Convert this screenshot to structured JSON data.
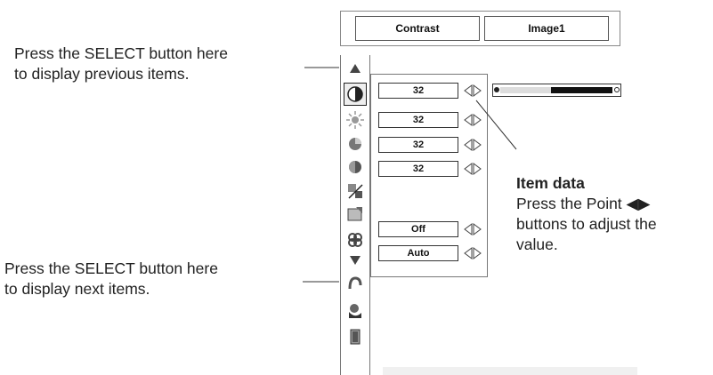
{
  "header": {
    "tab_contrast": "Contrast",
    "tab_image": "Image1"
  },
  "callouts": {
    "previous_line1": "Press the SELECT button here",
    "previous_line2": "to display previous items.",
    "next_line1": "Press the SELECT button here",
    "next_line2": "to display next items.",
    "item_title": "Item data",
    "item_line1": "Press the Point ◀▶",
    "item_line2": "buttons to adjust the",
    "item_line3": "value."
  },
  "menu_icons": [
    "up-arrow-icon",
    "contrast-icon",
    "brightness-icon",
    "color-icon",
    "tint-icon",
    "white-balance-icon",
    "sharpness-icon",
    "gamma-icon",
    "down-arrow-icon",
    "return-icon",
    "store-icon",
    "exit-icon"
  ],
  "panel": {
    "rows": [
      {
        "value": "32"
      },
      {
        "value": "32"
      },
      {
        "value": "32"
      },
      {
        "value": "32"
      },
      {
        "value": "Off"
      },
      {
        "value": "Auto"
      }
    ]
  },
  "slider": {
    "level_fraction": 0.45
  },
  "colors": {
    "line": "#333333",
    "icon_dark": "#444444",
    "icon_mid": "#888888",
    "slider_dark": "#111111",
    "slider_light": "#dddddd"
  }
}
